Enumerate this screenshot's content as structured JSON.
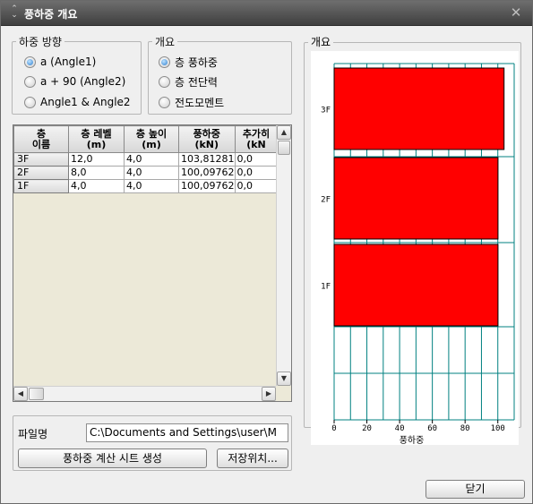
{
  "window": {
    "title": "풍하중 개요",
    "close_symbol": "✕"
  },
  "load_direction": {
    "legend": "하중 방향",
    "options": [
      {
        "label": "a  (Angle1)",
        "selected": true
      },
      {
        "label": "a + 90 (Angle2)",
        "selected": false
      },
      {
        "label": "Angle1 & Angle2",
        "selected": false
      }
    ]
  },
  "overview": {
    "legend": "개요",
    "options": [
      {
        "label": "층 풍하중",
        "selected": true
      },
      {
        "label": "층 전단력",
        "selected": false
      },
      {
        "label": "전도모멘트",
        "selected": false
      }
    ]
  },
  "table": {
    "headers": [
      "층\n이름",
      "층 레벨\n(m)",
      "층 높이\n(m)",
      "풍하중\n(kN)",
      "추가히\n(kN"
    ],
    "rows": [
      [
        "3F",
        "12,0",
        "4,0",
        "103,81281",
        "0,0"
      ],
      [
        "2F",
        "8,0",
        "4,0",
        "100,09762",
        "0,0"
      ],
      [
        "1F",
        "4,0",
        "4,0",
        "100,09762",
        "0,0"
      ]
    ]
  },
  "file": {
    "label": "파일명",
    "path": "C:\\Documents and Settings\\user\\M",
    "generate_label": "풍하중 계산 시트 생성",
    "location_label": "저장위치..."
  },
  "chart_panel": {
    "legend": "개요"
  },
  "chart_data": {
    "type": "bar",
    "orientation": "horizontal",
    "categories": [
      "3F",
      "2F",
      "1F"
    ],
    "values": [
      103.81281,
      100.09762,
      100.09762
    ],
    "xlabel": "풍하중",
    "xlim": [
      0,
      110
    ],
    "xticks": [
      0,
      20,
      40,
      60,
      80,
      100
    ],
    "grid": true,
    "bar_color": "#ff0000",
    "grid_color": "#008080"
  },
  "footer": {
    "close_label": "닫기"
  },
  "colors": {
    "titlebar": "#4a4a4a",
    "radio_selected": "#2d7fd0",
    "grid_bg": "#ece9d8"
  }
}
